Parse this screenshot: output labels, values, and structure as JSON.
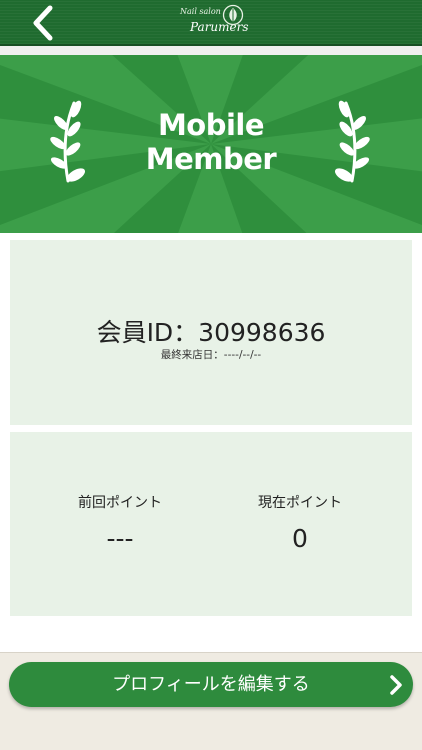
{
  "header": {
    "back_icon": "chevron-left-icon",
    "logo_small": "Nail salon",
    "logo_main": "Parumers",
    "logo_icon": "leaf-circle-icon"
  },
  "banner": {
    "title_line1": "Mobile",
    "title_line2": "Member",
    "wreath_icon": "laurel-branch-icon"
  },
  "member_card": {
    "id_text": "会員ID：30998636",
    "last_visit_text": "最終来店日：----/--/--"
  },
  "points_card": {
    "previous_label": "前回ポイント",
    "previous_value": "---",
    "current_label": "現在ポイント",
    "current_value": "0"
  },
  "footer": {
    "edit_profile_label": "プロフィールを編集する",
    "chevron_icon": "chevron-right-icon"
  },
  "colors": {
    "header": "#1f6b2f",
    "banner": "#2f8f3d",
    "card": "#e8f2e7",
    "button": "#2e8b3d"
  }
}
